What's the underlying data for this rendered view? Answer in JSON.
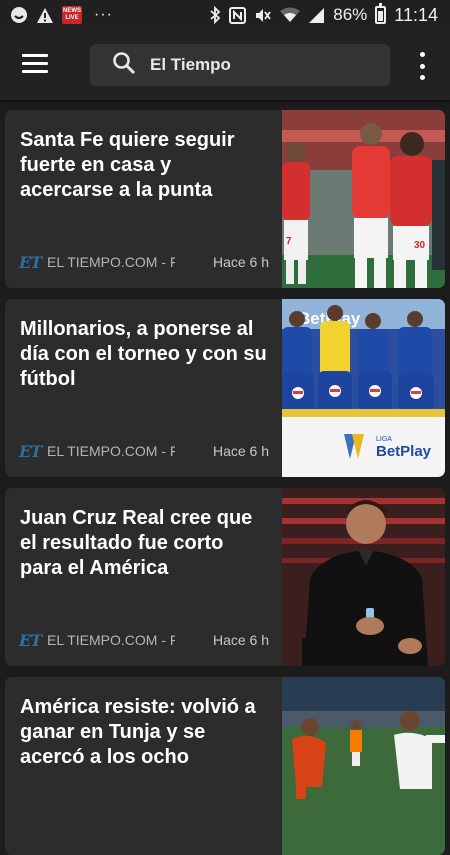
{
  "status_bar": {
    "news_badge": "NEWS LIVE",
    "more": "···",
    "battery": "86%",
    "battery_level": 0.86,
    "time": "11:14",
    "icons": [
      "face-icon",
      "warning-icon",
      "news-badge-icon",
      "bluetooth-icon",
      "nfc-icon",
      "mute-icon",
      "wifi-icon",
      "signal-icon",
      "battery-icon"
    ]
  },
  "app_bar": {
    "search_label": "El Tiempo",
    "icons": [
      "menu-icon",
      "search-icon",
      "more-vert-icon"
    ]
  },
  "cards": [
    {
      "title": "Santa Fe quiere seguir fuerte en casa y acercarse a la punta",
      "source": "EL TIEMPO.COM - Fút…",
      "time": "Hace 6 h"
    },
    {
      "title": "Millonarios, a ponerse al día con el torneo y con su fútbol",
      "source": "EL TIEMPO.COM - Fút…",
      "time": "Hace 6 h"
    },
    {
      "title": "Juan Cruz Real cree que el resultado fue corto para el América",
      "source": "EL TIEMPO.COM - Fút…",
      "time": "Hace 6 h"
    },
    {
      "title": "América resiste: volvió a ganar en Tunja y se acercó a los ocho",
      "source": "",
      "time": ""
    }
  ],
  "thumb_text": {
    "card1_jersey_numbers": [
      "7",
      "30"
    ],
    "card2_sponsor": "BetPlay",
    "card2_liga": "LIGA",
    "card2_banner": "BetPlay"
  },
  "source_logo": "ET",
  "colors": {
    "background": "#1c1c1c",
    "card": "#2c2c2c",
    "accent_logo": "#2f6f9f",
    "santa_fe_red": "#d32f2f",
    "millonarios_blue": "#1f4aa8"
  }
}
